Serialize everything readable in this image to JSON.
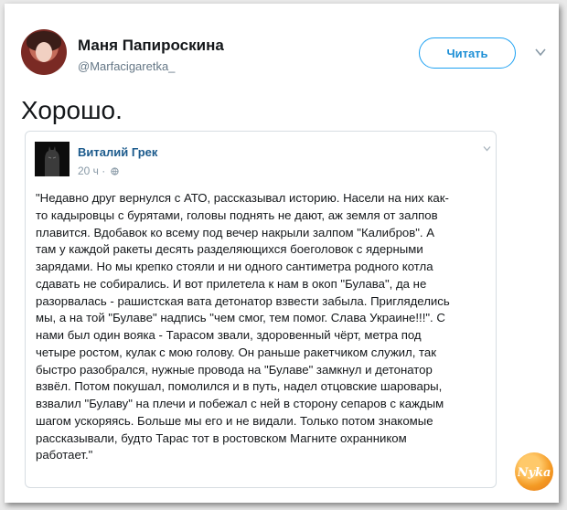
{
  "author": {
    "name": "Маня Папироскина",
    "handle": "@Marfacigaretka_"
  },
  "follow_label": "Читать",
  "tweet_text": "Хорошо.",
  "quoted": {
    "name": "Виталий Грек",
    "meta": "20 ч ·",
    "lines": [
      "\"Недавно друг вернулся с АТО, рассказывал историю. Насели на них как-",
      "то кадыровцы с бурятами, головы поднять не дают, аж земля от залпов",
      "плавится. Вдобавок ко всему под вечер накрыли залпом \"Калибров\". А",
      "там у каждой ракеты десять разделяющихся боеголовок с ядерными",
      "зарядами. Но мы крепко стояли и ни одного сантиметра родного котла",
      "сдавать не собирались. И вот прилетела к нам в окоп \"Булава\", да не",
      "разорвалась - рашистская вата детонатор взвести забыла. Пригляделись",
      "мы, а на той \"Булаве\" надпись \"чем смог, тем помог. Слава Украине!!!\". С",
      "нами был один вояка - Тарасом звали, здоровенный чёрт, метра под",
      "четыре ростом, кулак с мою голову. Он раньше ракетчиком служил, так",
      "быстро разобрался, нужные провода на \"Булаве\" замкнул и детонатор",
      "взвёл. Потом покушал, помолился и в путь, надел отцовские шаровары,",
      "взвалил \"Булаву\" на плечи и побежал с ней в сторону сепаров с каждым",
      "шагом ускоряясь. Больше мы его и не видали. Только потом знакомые",
      "рассказывали, будто Тарас тот в ростовском Магните охранником",
      "работает.\""
    ]
  },
  "icons": {
    "menu": "chevron-down-icon",
    "globe": "globe-icon",
    "watermark": "nyka-logo"
  },
  "colors": {
    "accent": "#1da1f2",
    "quoted_name": "#1b5a8c",
    "watermark": "#f49a24"
  },
  "watermark_text": "Nyka"
}
